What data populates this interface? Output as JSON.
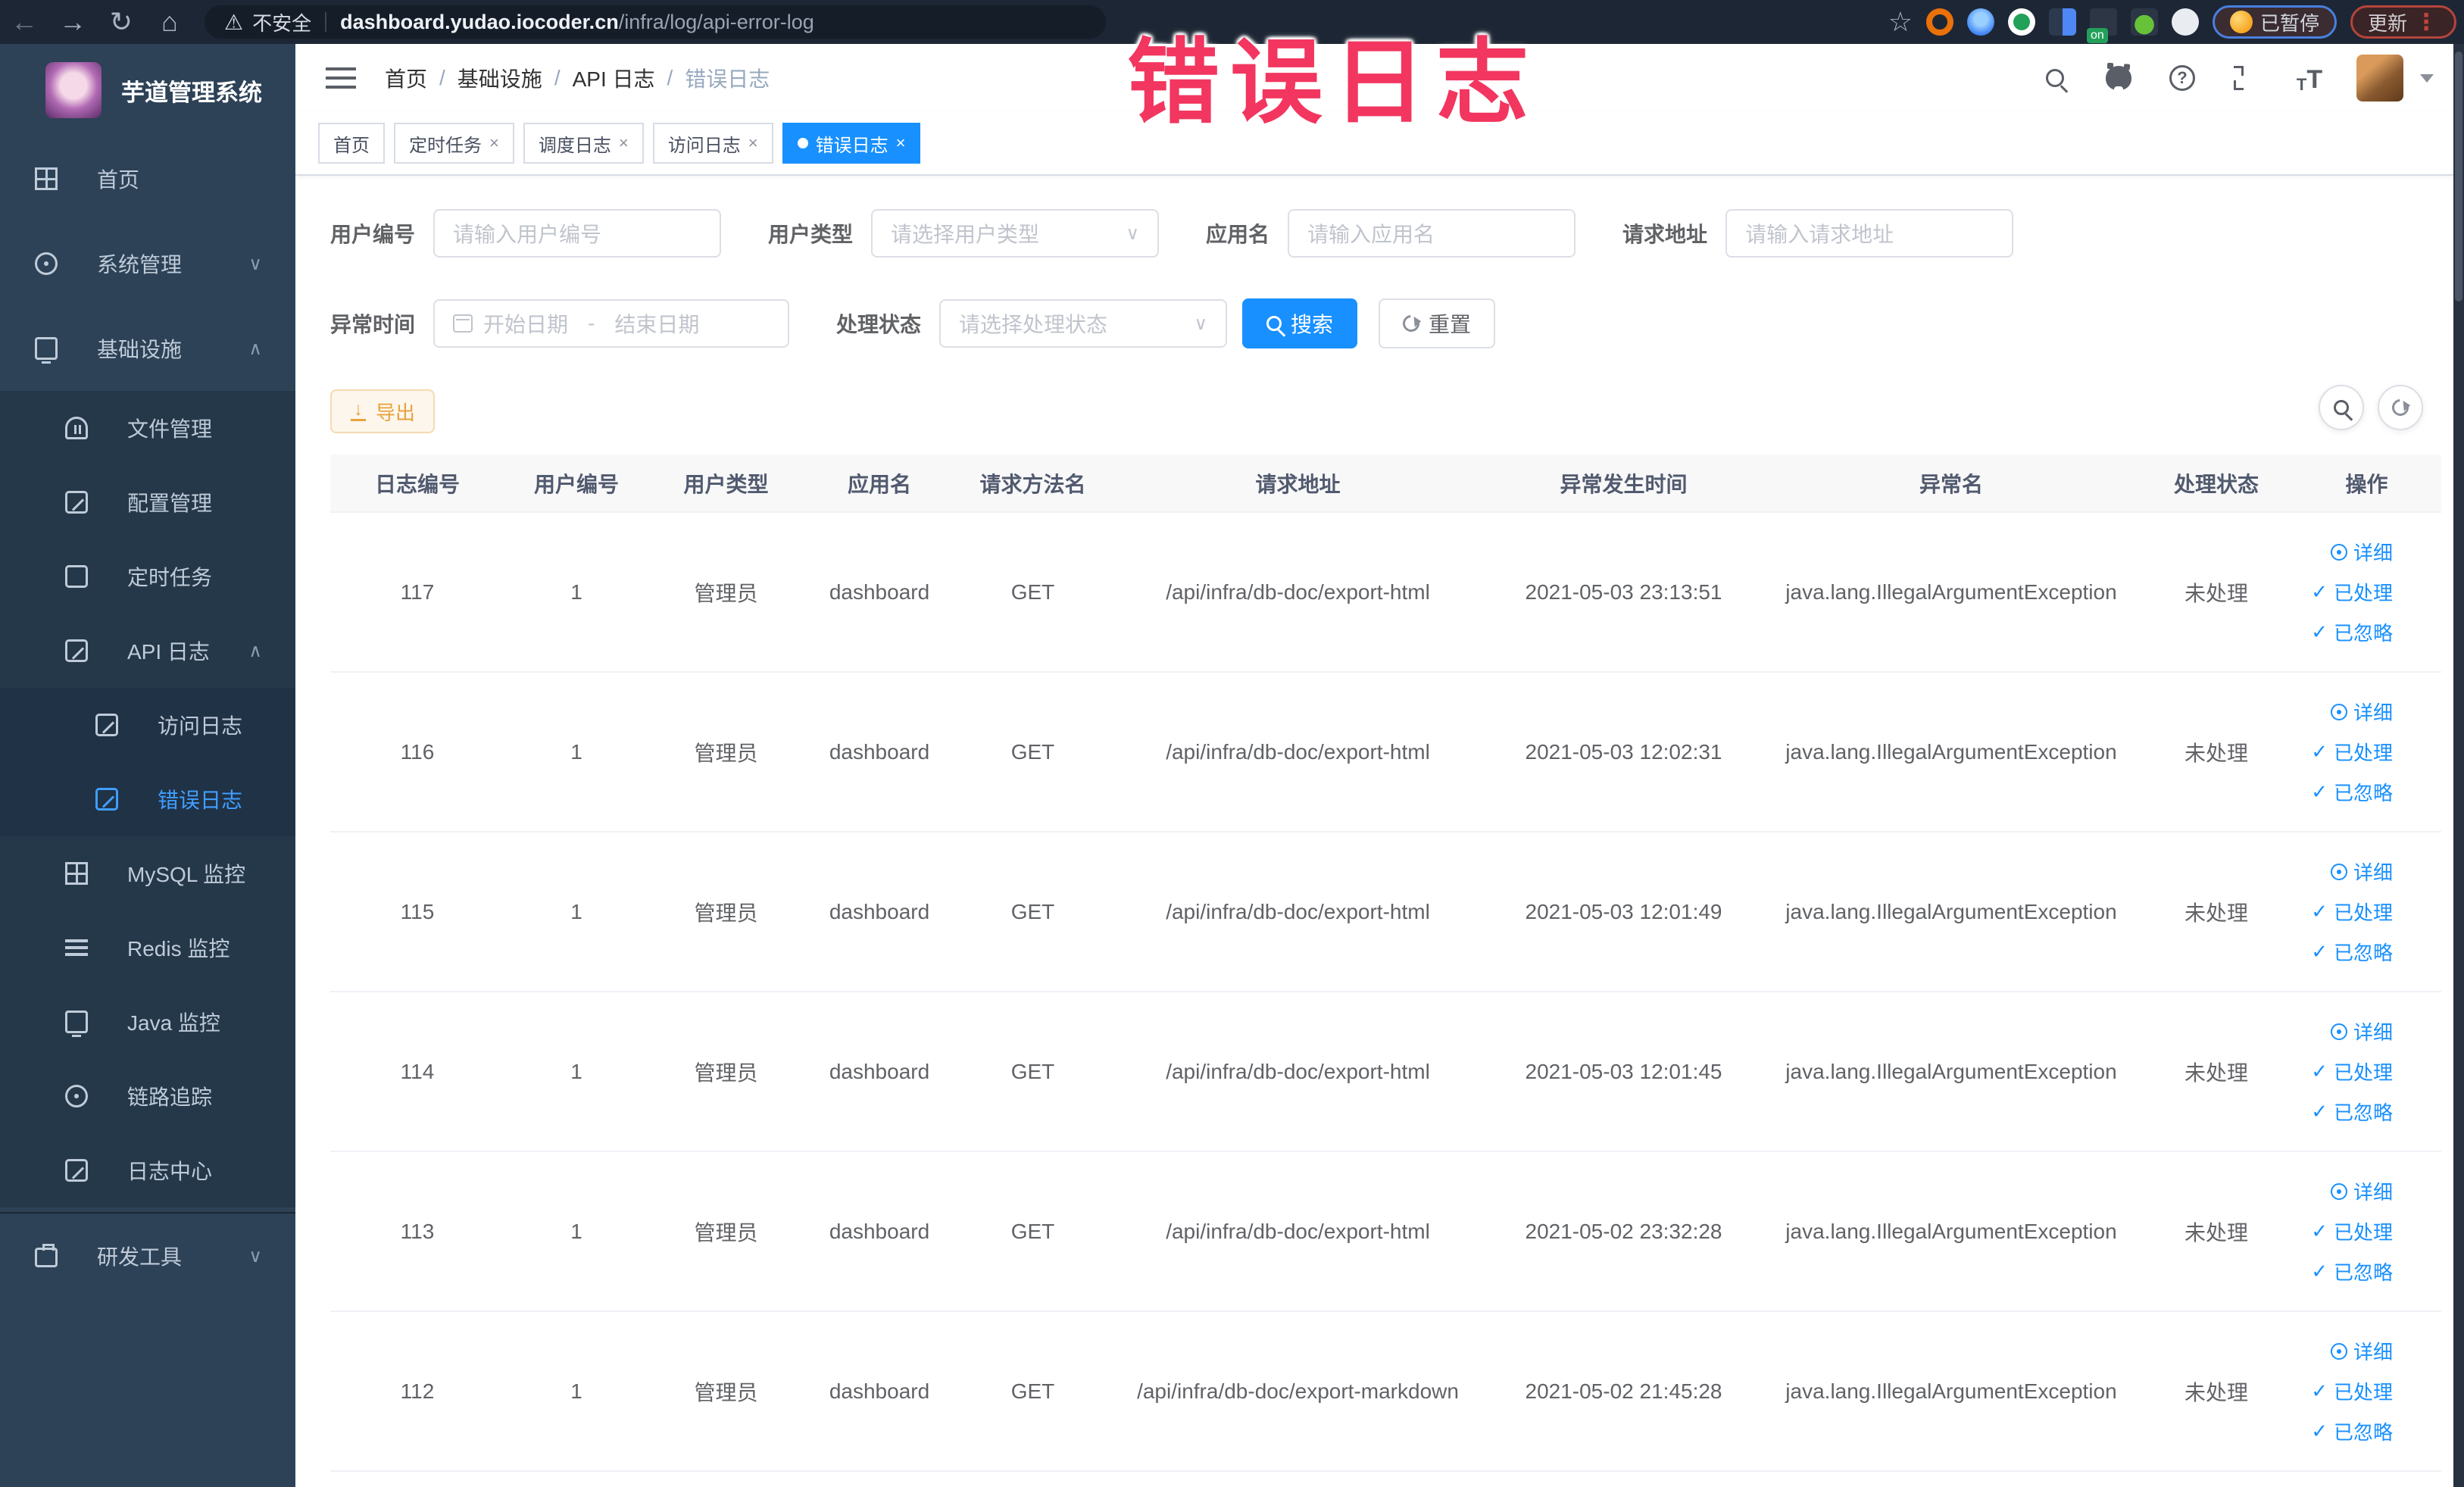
{
  "browser": {
    "security_label": "不安全",
    "url_host": "dashboard.yudao.iocoder.cn",
    "url_path": "/infra/log/api-error-log",
    "paused_button": "已暂停",
    "update_button": "更新"
  },
  "overlay": {
    "text": "错误日志",
    "color": "#f2365f"
  },
  "icons": {
    "back": "←",
    "forward": "→",
    "reload": "↻",
    "home": "⌂",
    "warning": "⚠",
    "star": "☆",
    "menu_dots": "⋮",
    "ext_on": "on",
    "chevron_down": "∨",
    "chevron_up": "∧",
    "close": "×",
    "question": "?",
    "font_small": "T",
    "font_big": "T",
    "check": "✓",
    "download_arrow": "↓",
    "range_separator": "-",
    "breadcrumb_separator": "/"
  },
  "sidebar": {
    "title": "芋道管理系统",
    "items": [
      {
        "label": "首页"
      },
      {
        "label": "系统管理"
      },
      {
        "label": "基础设施"
      },
      {
        "label": "文件管理"
      },
      {
        "label": "配置管理"
      },
      {
        "label": "定时任务"
      },
      {
        "label": "API 日志"
      },
      {
        "label": "访问日志"
      },
      {
        "label": "错误日志"
      },
      {
        "label": "MySQL 监控"
      },
      {
        "label": "Redis 监控"
      },
      {
        "label": "Java 监控"
      },
      {
        "label": "链路追踪"
      },
      {
        "label": "日志中心"
      },
      {
        "label": "研发工具"
      }
    ]
  },
  "header": {
    "breadcrumb": [
      "首页",
      "基础设施",
      "API 日志",
      "错误日志"
    ]
  },
  "tabs": [
    {
      "label": "首页"
    },
    {
      "label": "定时任务"
    },
    {
      "label": "调度日志"
    },
    {
      "label": "访问日志"
    },
    {
      "label": "错误日志"
    }
  ],
  "filters": {
    "user_id_label": "用户编号",
    "user_id_placeholder": "请输入用户编号",
    "user_type_label": "用户类型",
    "user_type_placeholder": "请选择用户类型",
    "app_name_label": "应用名",
    "app_name_placeholder": "请输入应用名",
    "request_url_label": "请求地址",
    "request_url_placeholder": "请输入请求地址",
    "exception_time_label": "异常时间",
    "date_start_placeholder": "开始日期",
    "date_end_placeholder": "结束日期",
    "process_status_label": "处理状态",
    "process_status_placeholder": "请选择处理状态",
    "search_button": "搜索",
    "reset_button": "重置"
  },
  "toolbar": {
    "export_button": "导出"
  },
  "table": {
    "columns": [
      "日志编号",
      "用户编号",
      "用户类型",
      "应用名",
      "请求方法名",
      "请求地址",
      "异常发生时间",
      "异常名",
      "处理状态",
      "操作"
    ],
    "action_labels": {
      "detail": "详细",
      "processed": "已处理",
      "ignored": "已忽略"
    },
    "rows": [
      {
        "log_id": "117",
        "user_id": "1",
        "user_type": "管理员",
        "app_name": "dashboard",
        "method": "GET",
        "url": "/api/infra/db-doc/export-html",
        "time": "2021-05-03 23:13:51",
        "exception": "java.lang.IllegalArgumentException",
        "status": "未处理"
      },
      {
        "log_id": "116",
        "user_id": "1",
        "user_type": "管理员",
        "app_name": "dashboard",
        "method": "GET",
        "url": "/api/infra/db-doc/export-html",
        "time": "2021-05-03 12:02:31",
        "exception": "java.lang.IllegalArgumentException",
        "status": "未处理"
      },
      {
        "log_id": "115",
        "user_id": "1",
        "user_type": "管理员",
        "app_name": "dashboard",
        "method": "GET",
        "url": "/api/infra/db-doc/export-html",
        "time": "2021-05-03 12:01:49",
        "exception": "java.lang.IllegalArgumentException",
        "status": "未处理"
      },
      {
        "log_id": "114",
        "user_id": "1",
        "user_type": "管理员",
        "app_name": "dashboard",
        "method": "GET",
        "url": "/api/infra/db-doc/export-html",
        "time": "2021-05-03 12:01:45",
        "exception": "java.lang.IllegalArgumentException",
        "status": "未处理"
      },
      {
        "log_id": "113",
        "user_id": "1",
        "user_type": "管理员",
        "app_name": "dashboard",
        "method": "GET",
        "url": "/api/infra/db-doc/export-html",
        "time": "2021-05-02 23:32:28",
        "exception": "java.lang.IllegalArgumentException",
        "status": "未处理"
      },
      {
        "log_id": "112",
        "user_id": "1",
        "user_type": "管理员",
        "app_name": "dashboard",
        "method": "GET",
        "url": "/api/infra/db-doc/export-markdown",
        "time": "2021-05-02 21:45:28",
        "exception": "java.lang.IllegalArgumentException",
        "status": "未处理"
      }
    ]
  },
  "colors": {
    "accent": "#1890ff",
    "active_menu": "#409eff",
    "warning": "#e6a23c",
    "overlay_red": "#f2365f"
  }
}
